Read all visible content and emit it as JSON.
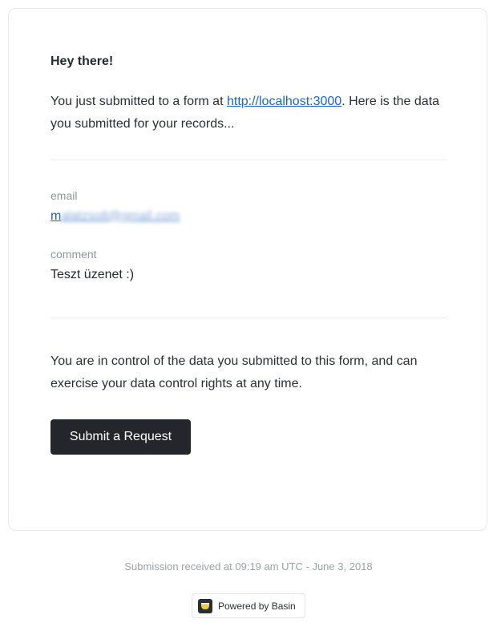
{
  "email": {
    "greeting": "Hey there!",
    "intro_prefix": "You just submitted to a form at ",
    "intro_link": "http://localhost:3000",
    "intro_suffix": ". Here is the data you submitted for your records...",
    "fields": [
      {
        "label": "email",
        "value_visible": "m",
        "value_blurred": "alatzsolt@gmail.com"
      },
      {
        "label": "comment",
        "value": "Teszt üzenet :)"
      }
    ],
    "control_text": "You are in control of the data you submitted to this form, and can exercise your data control rights at any time.",
    "button_label": "Submit a Request"
  },
  "footer": {
    "submission_text": "Submission received at 09:19 am UTC - June 3, 2018",
    "powered_by": "Powered by Basin",
    "powered_icon": "basin-logo-icon"
  },
  "colors": {
    "button_bg": "#23272b",
    "link": "#1a66c7",
    "muted": "#8e959c"
  }
}
